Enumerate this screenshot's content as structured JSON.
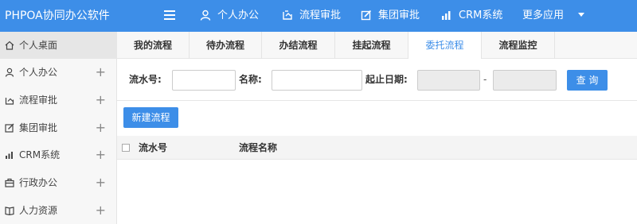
{
  "header": {
    "brand": "PHPOA协同办公软件",
    "nav": [
      {
        "label": "个人办公",
        "icon": "user-icon"
      },
      {
        "label": "流程审批",
        "icon": "workflow-icon"
      },
      {
        "label": "集团审批",
        "icon": "edit-icon"
      },
      {
        "label": "CRM系统",
        "icon": "bar-chart-icon"
      },
      {
        "label": "更多应用",
        "icon": "caret-down-icon"
      }
    ]
  },
  "sidebar": {
    "items": [
      {
        "label": "个人桌面",
        "icon": "home-icon",
        "active": true
      },
      {
        "label": "个人办公",
        "icon": "user-icon"
      },
      {
        "label": "流程审批",
        "icon": "workflow-icon"
      },
      {
        "label": "集团审批",
        "icon": "edit-icon"
      },
      {
        "label": "CRM系统",
        "icon": "bar-chart-icon"
      },
      {
        "label": "行政办公",
        "icon": "briefcase-icon"
      },
      {
        "label": "人力资源",
        "icon": "book-icon"
      }
    ],
    "expand_symbol": "+"
  },
  "tabs": [
    "我的流程",
    "待办流程",
    "办结流程",
    "挂起流程",
    "委托流程",
    "流程监控"
  ],
  "active_tab": "委托流程",
  "filter": {
    "serial_label": "流水号:",
    "serial_value": "",
    "name_label": "名称:",
    "name_value": "",
    "date_label": "起止日期:",
    "date_separator": "-",
    "date_start": "",
    "date_end": "",
    "query_label": "查 询"
  },
  "actions": {
    "new_flow_label": "新建流程"
  },
  "table": {
    "columns": [
      "流水号",
      "流程名称"
    ],
    "rows": []
  },
  "colors": {
    "primary": "#3d8ee8",
    "sidebar_bg": "#f7f7f7",
    "active_item_bg": "#e6e6e6"
  }
}
